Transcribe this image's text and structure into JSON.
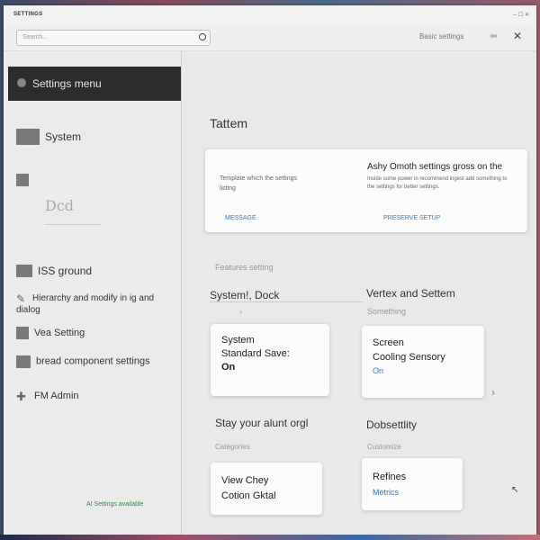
{
  "window": {
    "app_title": "SETTINGS",
    "controls": "─ ☐ ✕"
  },
  "toolbar": {
    "search_placeholder": "Search...",
    "link_label": "Basic settings",
    "menu_icon": "hamburger-icon",
    "tool_icon": "wrench-icon"
  },
  "sidebar": {
    "header_label": "Settings menu",
    "items": [
      {
        "label": "System",
        "icon": "monitor-icon"
      },
      {
        "label": "",
        "icon": "square-icon"
      },
      {
        "label": "ISS ground",
        "icon": "storage-icon"
      },
      {
        "label": "Hierarchy and modify in ig and dialog",
        "icon": "pencil-icon"
      },
      {
        "label": "Vea Setting",
        "icon": "shield-icon"
      },
      {
        "label": "bread component settings",
        "icon": "calendar-icon"
      },
      {
        "label": "FM Admin",
        "icon": "puzzle-icon"
      }
    ],
    "thumb_text": "Dcd",
    "footer_text": "AI Settings available"
  },
  "main": {
    "page_title": "Tattem",
    "feature_card": {
      "left_title": "Template which the settings",
      "left_sub": "listing",
      "right_title": "Ashy Omoth settings gross on the",
      "right_desc": "Inside some power in recommend ingest add something to the settings for better settings.",
      "link1": "MESSAGE",
      "link2": "PRESERVE SETUP"
    },
    "features_label": "Features setting",
    "section1_left_title": "System!, Dock",
    "section1_right_title": "Vertex and Settem",
    "section1_right_sub": "Something",
    "cards_row1": [
      {
        "line1": "System",
        "line2": "Standard Save:",
        "link": "On"
      },
      {
        "line1": "Screen",
        "line2": "Cooling Sensory",
        "link": "On"
      }
    ],
    "section2_left_title": "Stay your alunt orgl",
    "section2_left_sub": "Categories",
    "section2_right_title": "Dobsettlity",
    "section2_right_sub": "Customize",
    "cards_row2": [
      {
        "line1": "View Chey",
        "line2": "Cotion Gktal",
        "link": ""
      },
      {
        "line1": "Refines",
        "line2": "",
        "link": "Metrics"
      }
    ]
  }
}
